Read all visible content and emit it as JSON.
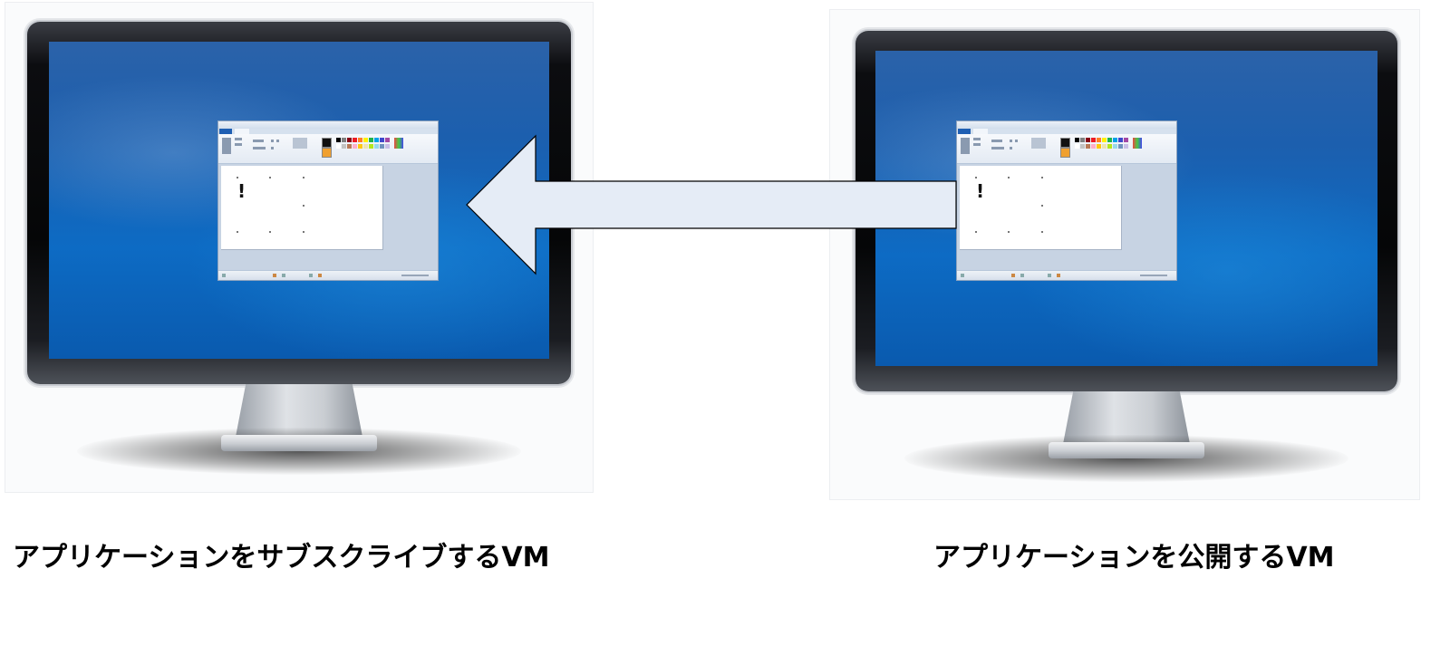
{
  "left_vm": {
    "caption": "アプリケーションをサブスクライブするVM",
    "app_window_glyph": "!"
  },
  "right_vm": {
    "caption": "アプリケーションを公開するVM",
    "app_window_glyph": "!"
  },
  "colors": {
    "arrow_fill": "#e5ecf6",
    "arrow_stroke": "#000000",
    "screen_blue": "#1c5fae",
    "caption_text": "#000000"
  },
  "icons": {
    "monitor": "monitor-icon",
    "app_window": "paint-window-icon",
    "arrow": "left-arrow-icon"
  }
}
